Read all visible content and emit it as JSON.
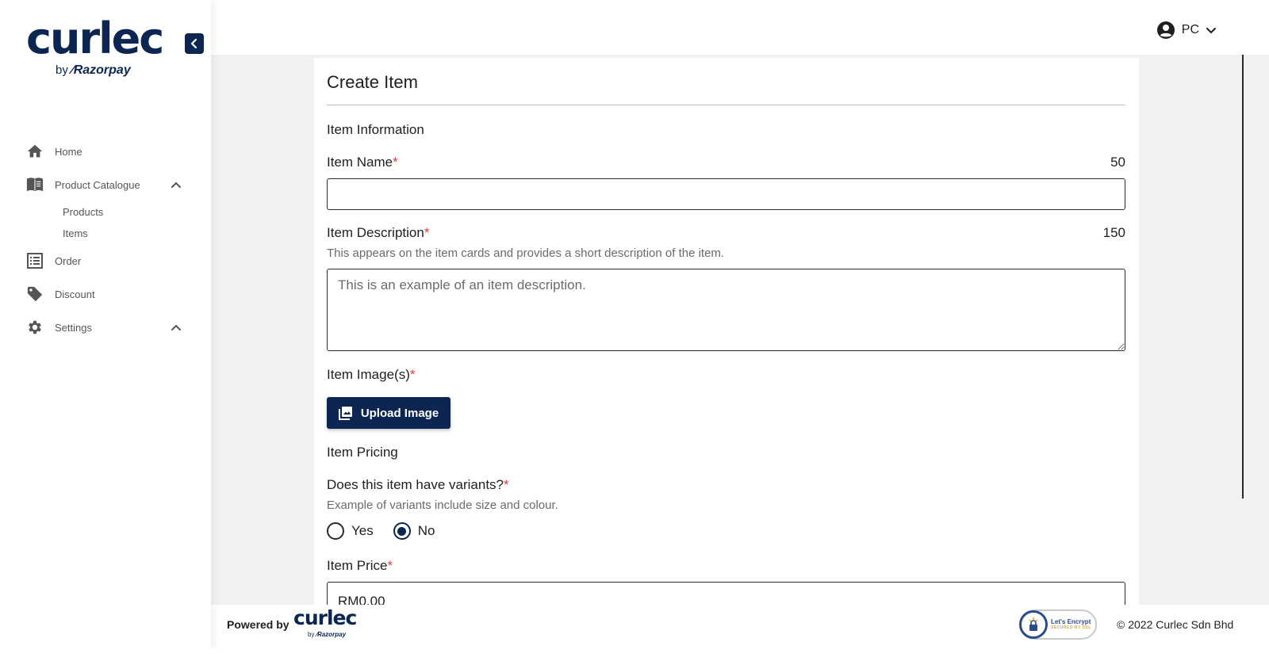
{
  "brand": {
    "logo_word": "curlec",
    "logo_by": "by",
    "logo_partner": "Razorpay",
    "color": "#0c2551"
  },
  "sidebar": {
    "collapse_icon": "chevron-left-icon",
    "items": [
      {
        "label": "Home",
        "icon": "home-icon"
      },
      {
        "label": "Product Catalogue",
        "icon": "book-icon",
        "expanded": true,
        "children": [
          {
            "label": "Products"
          },
          {
            "label": "Items"
          }
        ]
      },
      {
        "label": "Order",
        "icon": "list-icon"
      },
      {
        "label": "Discount",
        "icon": "tag-icon"
      },
      {
        "label": "Settings",
        "icon": "gear-icon",
        "expanded": true
      }
    ]
  },
  "header": {
    "user_initials": "PC",
    "user_icon": "account-circle-icon"
  },
  "form": {
    "title": "Create Item",
    "section_info": "Item Information",
    "item_name": {
      "label": "Item Name",
      "required_mark": "*",
      "counter": "50",
      "value": ""
    },
    "item_description": {
      "label": "Item Description",
      "required_mark": "*",
      "counter": "150",
      "helper": "This appears on the item cards and provides a short description of the item.",
      "placeholder": "This is an example of an item description."
    },
    "item_images": {
      "label": "Item Image(s)",
      "required_mark": "*",
      "button_label": "Upload Image"
    },
    "section_pricing": "Item Pricing",
    "variants": {
      "label": "Does this item have variants?",
      "required_mark": "*",
      "helper": "Example of variants include size and colour.",
      "options": [
        {
          "label": "Yes",
          "selected": false
        },
        {
          "label": "No",
          "selected": true
        }
      ]
    },
    "item_price": {
      "label": "Item Price",
      "required_mark": "*",
      "value": "RM0.00"
    }
  },
  "footer": {
    "powered_by": "Powered by",
    "logo_word": "curlec",
    "logo_by": "by",
    "logo_partner": "Razorpay",
    "badge_line1": "Let's Encrypt",
    "badge_line2": "SECURED BY SSL",
    "copyright": "© 2022 Curlec Sdn Bhd"
  }
}
